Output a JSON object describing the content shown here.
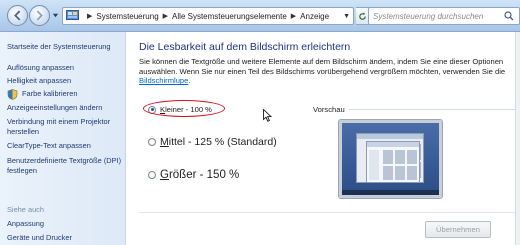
{
  "address_bar": {
    "breadcrumbs": [
      "Systemsteuerung",
      "Alle Systemsteuerungselemente",
      "Anzeige"
    ]
  },
  "search": {
    "placeholder": "Systemsteuerung durchsuchen"
  },
  "left_pane": {
    "links": [
      "Startseite der Systemsteuerung",
      "Auflösung anpassen",
      "Helligkeit anpassen",
      "Farbe kalibrieren",
      "Anzeigeeinstellungen ändern",
      "Verbindung mit einem Projektor herstellen",
      "ClearType-Text anpassen",
      "Benutzerdefinierte Textgröße (DPI) festlegen"
    ],
    "see_also": "Siehe auch",
    "see_also_links": [
      "Anpassung",
      "Geräte und Drucker"
    ],
    "icons": [
      "shield-icon"
    ]
  },
  "main": {
    "heading": "Die Lesbarkeit auf dem Bildschirm erleichtern",
    "description": "Sie können die Textgröße und weitere Elemente auf dem Bildschirm ändern, indem Sie eine dieser Optionen auswählen. Wenn Sie nur einen Teil des Bildschirms vorübergehend vergrößern möchten, verwenden Sie die",
    "description_link": "Bildschirmlupe",
    "description_end": ".",
    "options": [
      {
        "underlined": "K",
        "rest": "leiner - 100 %",
        "checked": true
      },
      {
        "underlined": "M",
        "rest": "ittel - 125 % (Standard)",
        "checked": false
      },
      {
        "underlined": "G",
        "rest": "rößer - 150 %",
        "checked": false
      }
    ],
    "preview_label": "Vorschau",
    "apply_button": "Übernehmen"
  },
  "colors": {
    "heading": "#1e3287",
    "link": "#1f3a75",
    "highlight": "#d0141e"
  }
}
